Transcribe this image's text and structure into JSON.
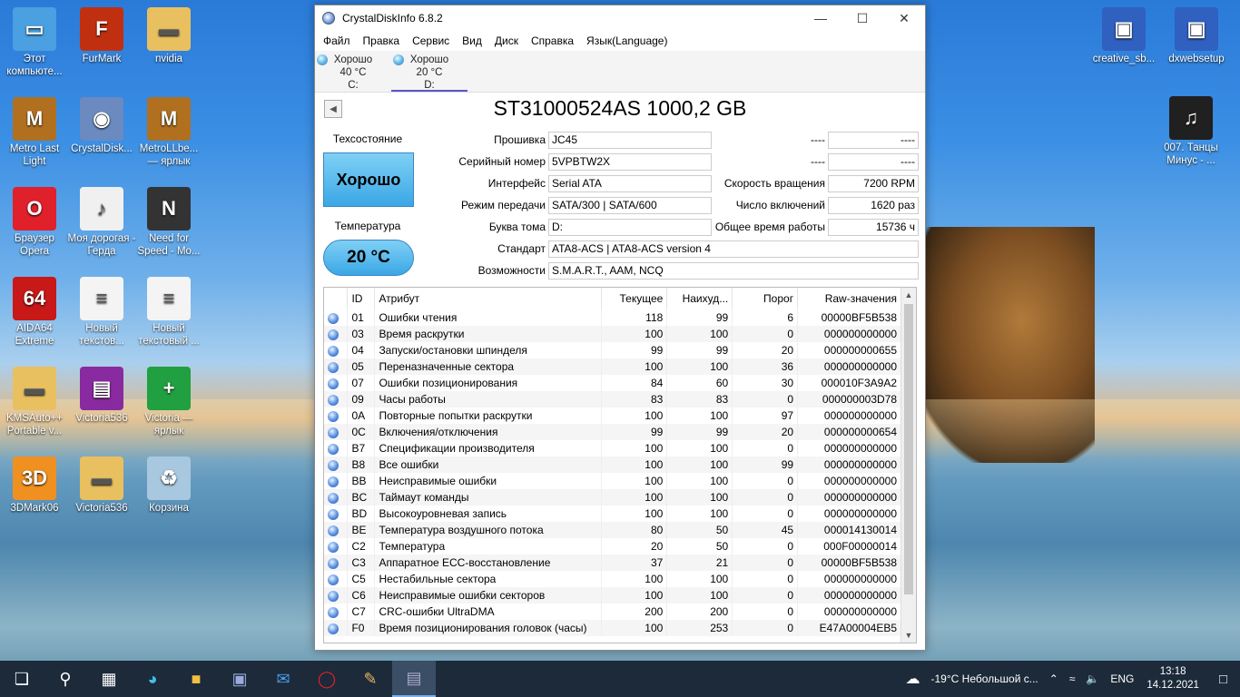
{
  "desktop": {
    "icons_left": [
      {
        "label": "Этот компьюте...",
        "icon": "computer-icon",
        "color": "#4aa0e0"
      },
      {
        "label": "FurMark",
        "icon": "furmark-icon",
        "color": "#c03010"
      },
      {
        "label": "nvidia",
        "icon": "folder-icon",
        "color": "#e8c060"
      },
      {
        "label": "Metro Last Light",
        "icon": "metro-icon",
        "color": "#b07020"
      },
      {
        "label": "CrystalDisk...",
        "icon": "crystaldisk-icon",
        "color": "#6a8ac0"
      },
      {
        "label": "MetroLLbe... — ярлык",
        "icon": "metro-icon",
        "color": "#b07020"
      },
      {
        "label": "Браузер Opera",
        "icon": "opera-icon",
        "color": "#e0202a"
      },
      {
        "label": "Моя дорогая - Герда",
        "icon": "audio-file-icon",
        "color": "#f0f0f0"
      },
      {
        "label": "Need for Speed - Mo...",
        "icon": "nfs-icon",
        "color": "#333333"
      },
      {
        "label": "AIDA64 Extreme",
        "icon": "aida64-icon",
        "color": "#c81818"
      },
      {
        "label": "Новый текстов...",
        "icon": "text-file-icon",
        "color": "#f4f4f4"
      },
      {
        "label": "Новый текстовый ...",
        "icon": "text-file-icon",
        "color": "#f4f4f4"
      },
      {
        "label": "KMSAuto++ Portable v...",
        "icon": "folder-icon",
        "color": "#e8c060"
      },
      {
        "label": "Victoria536",
        "icon": "winrar-icon",
        "color": "#8a2aa0"
      },
      {
        "label": "Victoria — ярлык",
        "icon": "victoria-icon",
        "color": "#20a040"
      },
      {
        "label": "3DMark06",
        "icon": "3dmark-icon",
        "color": "#f09020"
      },
      {
        "label": "Victoria536",
        "icon": "folder-icon",
        "color": "#e8c060"
      },
      {
        "label": "Корзина",
        "icon": "recycle-bin-icon",
        "color": "#a8c8e0"
      }
    ],
    "icons_right": [
      {
        "label": "creative_sb...",
        "icon": "installer-icon",
        "color": "#3060c0"
      },
      {
        "label": "dxwebsetup",
        "icon": "installer-icon",
        "color": "#3060c0"
      },
      {
        "label": "007. Танцы Минус - ...",
        "icon": "album-art-icon",
        "color": "#202020"
      }
    ]
  },
  "window": {
    "title": "CrystalDiskInfo 6.8.2",
    "menu": [
      "Файл",
      "Правка",
      "Сервис",
      "Вид",
      "Диск",
      "Справка",
      "Язык(Language)"
    ],
    "drives": [
      {
        "status": "Хорошо",
        "temp": "40 °C",
        "letter": "C:"
      },
      {
        "status": "Хорошо",
        "temp": "20 °C",
        "letter": "D:"
      }
    ],
    "model": "ST31000524AS 1000,2 GB",
    "health_label": "Техсостояние",
    "health_value": "Хорошо",
    "temp_label": "Температура",
    "temp_value": "20 °C",
    "info": {
      "firmware_label": "Прошивка",
      "firmware": "JC45",
      "serial_label": "Серийный номер",
      "serial": "5VPBTW2X",
      "interface_label": "Интерфейс",
      "interface": "Serial ATA",
      "transfer_label": "Режим передачи",
      "transfer": "SATA/300 | SATA/600",
      "volume_label": "Буква тома",
      "volume": "D:",
      "standard_label": "Стандарт",
      "standard": "ATA8-ACS | ATA8-ACS version 4",
      "features_label": "Возможности",
      "features": "S.M.A.R.T., AAM, NCQ",
      "r1_label": "----",
      "r1_value": "----",
      "r2_label": "----",
      "r2_value": "----",
      "rpm_label": "Скорость вращения",
      "rpm": "7200 RPM",
      "count_label": "Число включений",
      "count": "1620 раз",
      "hours_label": "Общее время работы",
      "hours": "15736 ч"
    },
    "table": {
      "headers": [
        "ID",
        "Атрибут",
        "Текущее",
        "Наихуд...",
        "Порог",
        "Raw-значения"
      ],
      "rows": [
        [
          "01",
          "Ошибки чтения",
          "118",
          "99",
          "6",
          "00000BF5B538"
        ],
        [
          "03",
          "Время раскрутки",
          "100",
          "100",
          "0",
          "000000000000"
        ],
        [
          "04",
          "Запуски/остановки шпинделя",
          "99",
          "99",
          "20",
          "000000000655"
        ],
        [
          "05",
          "Переназначенные сектора",
          "100",
          "100",
          "36",
          "000000000000"
        ],
        [
          "07",
          "Ошибки позиционирования",
          "84",
          "60",
          "30",
          "000010F3A9A2"
        ],
        [
          "09",
          "Часы работы",
          "83",
          "83",
          "0",
          "000000003D78"
        ],
        [
          "0A",
          "Повторные попытки раскрутки",
          "100",
          "100",
          "97",
          "000000000000"
        ],
        [
          "0C",
          "Включения/отключения",
          "99",
          "99",
          "20",
          "000000000654"
        ],
        [
          "B7",
          "Спецификации производителя",
          "100",
          "100",
          "0",
          "000000000000"
        ],
        [
          "B8",
          "Все ошибки",
          "100",
          "100",
          "99",
          "000000000000"
        ],
        [
          "BB",
          "Неисправимые ошибки",
          "100",
          "100",
          "0",
          "000000000000"
        ],
        [
          "BC",
          "Таймаут команды",
          "100",
          "100",
          "0",
          "000000000000"
        ],
        [
          "BD",
          "Высокоуровневая запись",
          "100",
          "100",
          "0",
          "000000000000"
        ],
        [
          "BE",
          "Температура воздушного потока",
          "80",
          "50",
          "45",
          "000014130014"
        ],
        [
          "C2",
          "Температура",
          "20",
          "50",
          "0",
          "000F00000014"
        ],
        [
          "C3",
          "Аппаратное ECC-восстановление",
          "37",
          "21",
          "0",
          "00000BF5B538"
        ],
        [
          "C5",
          "Нестабильные сектора",
          "100",
          "100",
          "0",
          "000000000000"
        ],
        [
          "C6",
          "Неисправимые ошибки секторов",
          "100",
          "100",
          "0",
          "000000000000"
        ],
        [
          "C7",
          "CRC-ошибки UltraDMA",
          "200",
          "200",
          "0",
          "000000000000"
        ],
        [
          "F0",
          "Время позиционирования головок (часы)",
          "100",
          "253",
          "0",
          "E47A00004EB5"
        ]
      ]
    }
  },
  "taskbar": {
    "weather": "-19°C  Небольшой с...",
    "lang": "ENG",
    "time": "13:18",
    "date": "14.12.2021"
  }
}
